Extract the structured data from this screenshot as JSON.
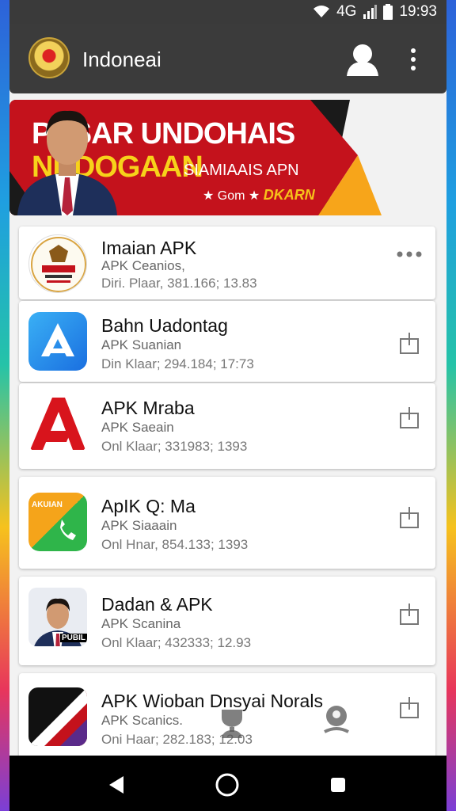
{
  "status_bar": {
    "signal_label": "4G",
    "time": "19:93"
  },
  "app_bar": {
    "title": "Indoneai",
    "logo_icon": "emblem-logo",
    "profile_icon": "person-icon",
    "menu_icon": "more-vert-icon"
  },
  "banner": {
    "line1": "PUSAR UNDOHAIS",
    "line2": "NDDOGAAN",
    "line2_sub": "SIAMIAAIS APN",
    "tag_prefix": "★ Gom ★",
    "tag_brand": "DKARN",
    "colors": {
      "red": "#c4121c",
      "dark": "#1a1a1a",
      "yellow": "#f7d21a"
    }
  },
  "apps": [
    {
      "name": "Imaian APK",
      "subtitle": "APK Ceanios,",
      "meta": "Diri. Plaar, 381.166; 13.83",
      "icon": "emblem-badge-icon",
      "action": "more-dots-icon"
    },
    {
      "name": "Bahn Uadontag",
      "subtitle": "APK Suanian",
      "meta": "Din Klaar; 294.184; 17:73",
      "icon": "blue-a-app-icon",
      "action": "share-icon"
    },
    {
      "name": "APK Mraba",
      "subtitle": "APK Saeain",
      "meta": "Onl Klaar; 331983; 1393",
      "icon": "red-a-app-icon",
      "action": "share-icon"
    },
    {
      "name": "ApIK Q: Ma",
      "subtitle": "APK Siaaain",
      "meta": "Onl Hnar, 854.133; 1393",
      "icon": "orange-green-phone-icon",
      "action": "share-icon",
      "icon_label": "AKUIAN"
    },
    {
      "name": "Dadan & APK",
      "subtitle": "APK Scanina",
      "meta": "Onl Klaar; 432333; 12.93",
      "icon": "portrait-app-icon",
      "action": "share-icon",
      "icon_label": "PUBIL"
    },
    {
      "name": "APK Wioban Dnsyai Norals",
      "subtitle": "APK Scanics.",
      "meta": "Oni Haar; 282.183; 12.03",
      "icon": "red-black-app-icon",
      "action": "share-icon"
    }
  ],
  "nav_bar": {
    "back_icon": "back-triangle-icon",
    "home_icon": "home-circle-icon",
    "recents_icon": "recents-square-icon"
  }
}
